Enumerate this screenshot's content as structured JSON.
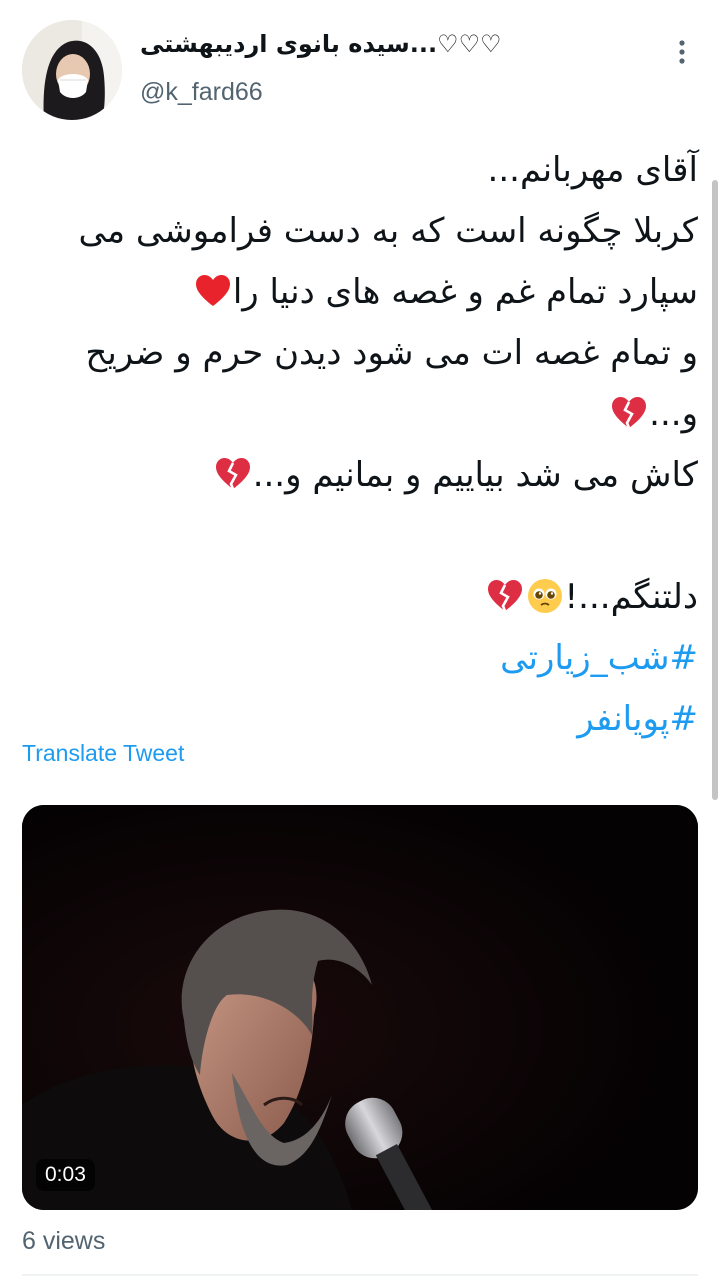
{
  "author": {
    "display_name": "سیده بانوی اردیبهشتی...♡♡♡",
    "handle": "@k_fard66",
    "avatar_icon": "avatar-woman-mask"
  },
  "more_icon": "more-vertical-icon",
  "tweet": {
    "lines": [
      "آقای مهربانم...",
      "کربلا چگونه است که به دست فراموشی می",
      "سپارد تمام غم و غصه های دنیا را",
      "و تمام غصه ات می شود دیدن حرم و ضریح",
      "و...",
      "کاش می شد بیاییم و بمانیم و...",
      "",
      "دلتنگم...!"
    ],
    "hashtags": [
      "#شب_زیارتی",
      "#پویانفر"
    ],
    "emojis": {
      "red_heart": "red-heart-emoji",
      "broken_heart": "broken-heart-emoji",
      "pleading_face": "pleading-face-emoji"
    }
  },
  "translate_label": "Translate Tweet",
  "video": {
    "duration": "0:03"
  },
  "views_label": "6 views",
  "colors": {
    "link": "#1d9bf0",
    "text": "#0f1419",
    "secondary": "#536471"
  }
}
